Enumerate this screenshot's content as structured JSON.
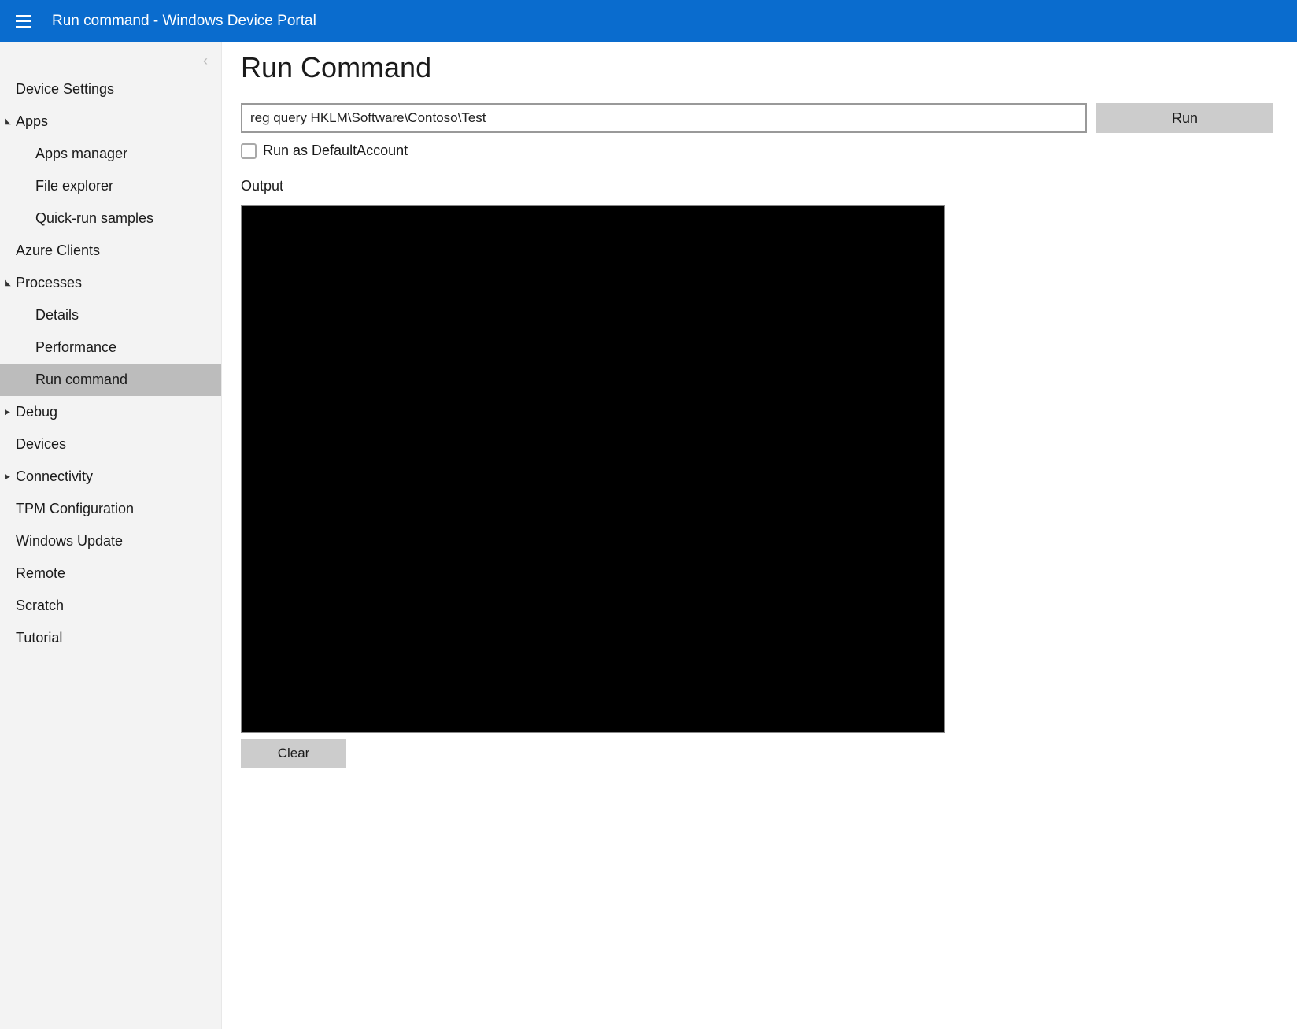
{
  "header": {
    "title": "Run command - Windows Device Portal"
  },
  "sidebar": {
    "items": [
      {
        "label": "Device Settings",
        "level": 0,
        "expanded": null,
        "active": false
      },
      {
        "label": "Apps",
        "level": 0,
        "expanded": true,
        "active": false
      },
      {
        "label": "Apps manager",
        "level": 1,
        "expanded": null,
        "active": false
      },
      {
        "label": "File explorer",
        "level": 1,
        "expanded": null,
        "active": false
      },
      {
        "label": "Quick-run samples",
        "level": 1,
        "expanded": null,
        "active": false
      },
      {
        "label": "Azure Clients",
        "level": 0,
        "expanded": null,
        "active": false
      },
      {
        "label": "Processes",
        "level": 0,
        "expanded": true,
        "active": false
      },
      {
        "label": "Details",
        "level": 1,
        "expanded": null,
        "active": false
      },
      {
        "label": "Performance",
        "level": 1,
        "expanded": null,
        "active": false
      },
      {
        "label": "Run command",
        "level": 1,
        "expanded": null,
        "active": true
      },
      {
        "label": "Debug",
        "level": 0,
        "expanded": false,
        "active": false
      },
      {
        "label": "Devices",
        "level": 0,
        "expanded": null,
        "active": false
      },
      {
        "label": "Connectivity",
        "level": 0,
        "expanded": false,
        "active": false
      },
      {
        "label": "TPM Configuration",
        "level": 0,
        "expanded": null,
        "active": false
      },
      {
        "label": "Windows Update",
        "level": 0,
        "expanded": null,
        "active": false
      },
      {
        "label": "Remote",
        "level": 0,
        "expanded": null,
        "active": false
      },
      {
        "label": "Scratch",
        "level": 0,
        "expanded": null,
        "active": false
      },
      {
        "label": "Tutorial",
        "level": 0,
        "expanded": null,
        "active": false
      }
    ]
  },
  "main": {
    "page_title": "Run Command",
    "command_input_value": "reg query HKLM\\Software\\Contoso\\Test",
    "run_button_label": "Run",
    "run_as_default_checked": false,
    "run_as_default_label": "Run as DefaultAccount",
    "output_label": "Output",
    "output_content": "",
    "clear_button_label": "Clear"
  }
}
